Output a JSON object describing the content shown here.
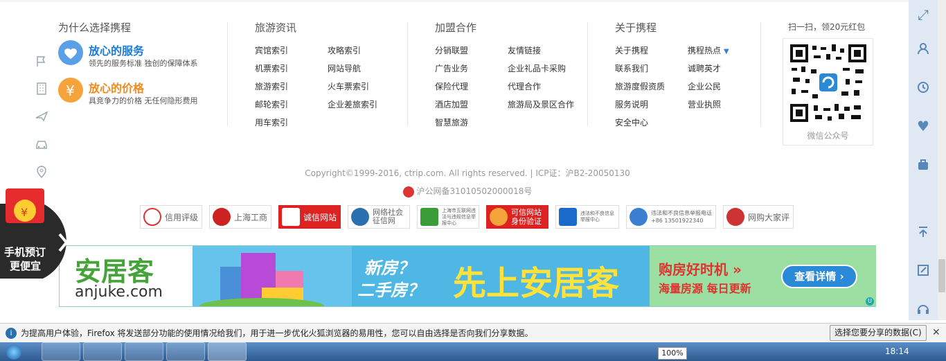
{
  "columns": {
    "why": {
      "title": "为什么选择携程"
    },
    "news": {
      "title": "旅游资讯",
      "links_a": [
        "宾馆索引",
        "机票索引",
        "旅游索引",
        "邮轮索引",
        "用车索引"
      ],
      "links_b": [
        "攻略索引",
        "网站导航",
        "火车票索引",
        "企业差旅索引"
      ]
    },
    "join": {
      "title": "加盟合作",
      "links_a": [
        "分销联盟",
        "广告业务",
        "保险代理",
        "酒店加盟",
        "智慧旅游"
      ],
      "links_b": [
        "友情链接",
        "企业礼品卡采购",
        "代理合作",
        "旅游局及景区合作"
      ]
    },
    "about": {
      "title": "关于携程",
      "links_a": [
        "关于携程",
        "联系我们",
        "旅游度假资质",
        "服务说明",
        "安全中心"
      ],
      "links_b": [
        "携程热点",
        "诚聘英才",
        "企业公民",
        "营业执照"
      ]
    }
  },
  "services": [
    {
      "title": "放心的服务",
      "subtitle": "领先的服务标准 独创的保障体系",
      "color": "#5aa0e6"
    },
    {
      "title": "放心的价格",
      "subtitle": "具竞争力的价格 无任何隐形费用",
      "color": "#f5a33b"
    }
  ],
  "qr": {
    "caption_top": "扫一扫，领20元红包",
    "caption_bottom": "微信公众号"
  },
  "copyright": {
    "line1": "Copyright©1999-2016, ctrip.com. All rights reserved. | ICP证：沪B2-20050130",
    "line2": "沪公网备31010502000018号"
  },
  "badges": [
    {
      "label": "信用评级",
      "color": "#d33"
    },
    {
      "label": "上海工商",
      "color": "#c22"
    },
    {
      "label": "诚信网站",
      "color": "#d22"
    },
    {
      "label": "网络社会征信网",
      "color": "#2a6fb0"
    },
    {
      "label": "上海市互联网违法与违规信息举报中心",
      "color": "#3a9d3a"
    },
    {
      "label": "可信网站身份验证",
      "color": "#d22"
    },
    {
      "label": "违法和不良信息举报中心",
      "color": "#1a6ac9"
    },
    {
      "label": "违法和不良信息举报电话 +86 13501922340",
      "color": "#3a7fd0"
    },
    {
      "label": "网购大家评",
      "color": "#c33"
    }
  ],
  "banner": {
    "brand_cn": "安居客",
    "brand_en": "anjuke.com",
    "q1": "新房？",
    "q2": "二手房？",
    "slogan": "先上安居客",
    "tag1": "购房好时机 »",
    "tag2": "海量房源 每日更新",
    "cta": "查看详情 ›"
  },
  "promo": {
    "text1": "手机预订",
    "text2": "更便宜"
  },
  "notification": {
    "text": "为提高用户体验，Firefox 将发送部分功能的使用情况给我们，用于进一步优化火狐浏览器的易用性，您可以自由选择是否向我们分享数据。",
    "button": "选择您要分享的数据(C)"
  },
  "taskbar": {
    "time": "18:14",
    "battery": "100%"
  }
}
